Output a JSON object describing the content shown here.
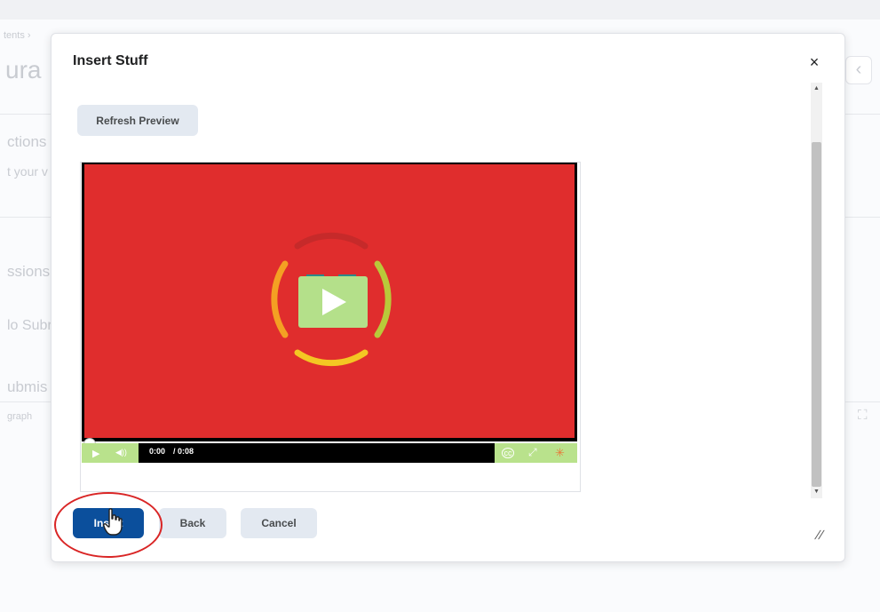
{
  "background": {
    "breadcrumb": "tents ›",
    "title_fragment": "ura",
    "section_instructions": "ctions",
    "instructions_text": "t your v",
    "section_submissions": "ssions",
    "no_submissions": "lo Subr",
    "submit_heading": "ubmis",
    "editor_toolbar": "graph",
    "nav_prev": "‹",
    "fullscreen_icon": "⛶"
  },
  "modal": {
    "title": "Insert Stuff",
    "close_label": "×",
    "refresh_button": "Refresh Preview",
    "video": {
      "current_time": "0:00",
      "duration": "/ 0:08",
      "play_icon": "▶",
      "volume_icon": "◀))",
      "cc_icon": "cc",
      "fullscreen_icon": "⤢",
      "logo_icon": "✳"
    },
    "buttons": {
      "insert": "Insert",
      "back": "Back",
      "cancel": "Cancel"
    },
    "resize_icon": "//"
  },
  "colors": {
    "primary": "#0b4f9c",
    "video_bg": "#e02d2d",
    "controls_accent": "#b9e28c",
    "highlight": "#d92525"
  }
}
